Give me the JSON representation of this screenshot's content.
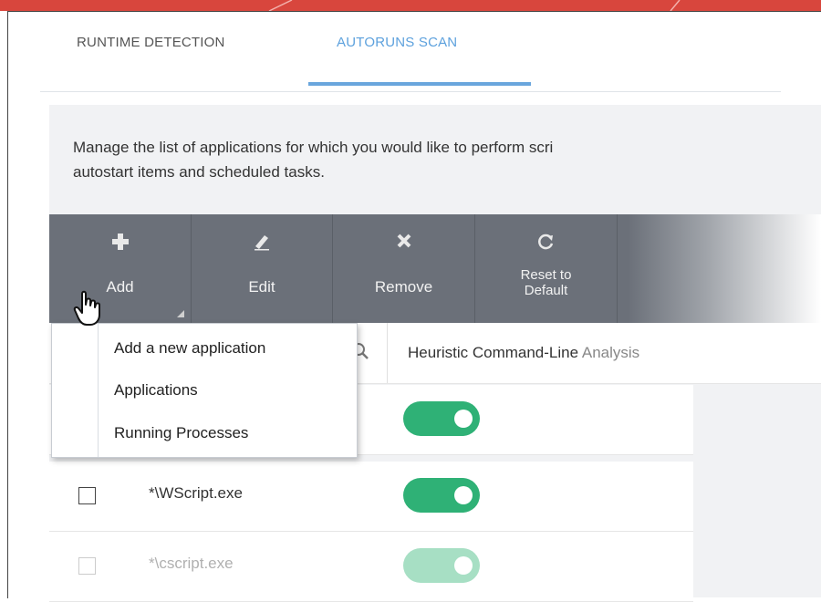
{
  "tabs": [
    {
      "label": "RUNTIME DETECTION"
    },
    {
      "label": "AUTORUNS SCAN"
    }
  ],
  "active_tab": "AUTORUNS SCAN",
  "description": {
    "line1": "Manage the list of applications for which you would like to perform scri",
    "line2": "autostart items and scheduled tasks."
  },
  "toolbar": {
    "add_label": "Add",
    "edit_label": "Edit",
    "remove_label": "Remove",
    "reset_label_1": "Reset to",
    "reset_label_2": "Default"
  },
  "table": {
    "column_header": "Heuristic Command-Line",
    "column_header_tail": "Analysis",
    "rows": [
      {
        "name": "",
        "enabled": true
      },
      {
        "name": "*\\WScript.exe",
        "enabled": true
      },
      {
        "name": "*\\cscript.exe",
        "enabled": true
      }
    ]
  },
  "add_menu": {
    "items": [
      "Add a new application",
      "Applications",
      "Running Processes"
    ]
  },
  "icons": {
    "add": "plus-icon",
    "edit": "pencil-icon",
    "remove": "x-icon",
    "reset": "reset-icon",
    "search": "search-icon",
    "cursor": "hand-cursor-icon"
  },
  "colors": {
    "accent_tab": "#5da1dd",
    "toggle_on": "#2fb176",
    "toolbar_bg": "#6b7079",
    "top_bar": "#d8463d"
  }
}
